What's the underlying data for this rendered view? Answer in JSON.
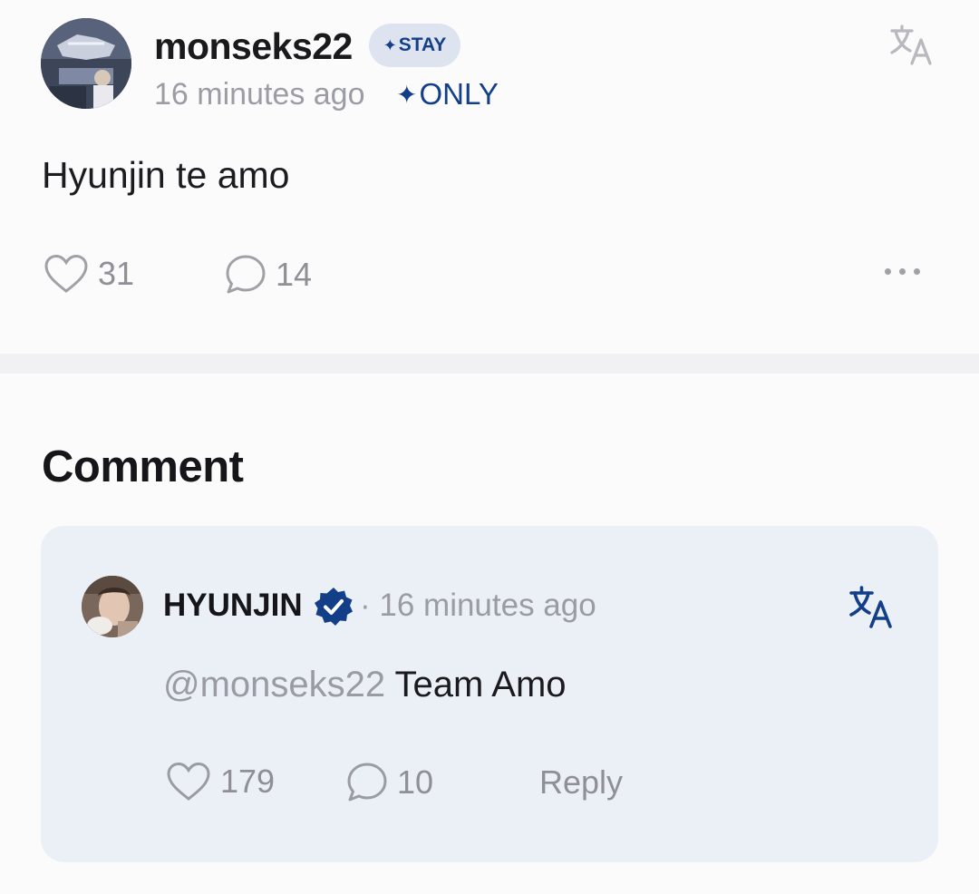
{
  "post": {
    "avatar_icon": "user-avatar-photo",
    "username": "monseks22",
    "stay_badge": {
      "icon": "sparkle-icon",
      "label": "STAY"
    },
    "time": "16 minutes ago",
    "only_badge": {
      "icon": "sparkle-icon",
      "label": "ONLY"
    },
    "translate_icon": "translate-icon",
    "text": "Hyunjin te amo",
    "likes": "31",
    "comments": "14",
    "more_icon": "more-horizontal-icon"
  },
  "comment_section": {
    "heading": "Comment",
    "comment": {
      "avatar_icon": "artist-avatar-photo",
      "author": "HYUNJIN",
      "verified_icon": "verified-badge-icon",
      "time": "· 16 minutes ago",
      "mention": "@monseks22",
      "text": " Team Amo",
      "likes": "179",
      "replies": "10",
      "reply_label": "Reply",
      "translate_icon": "translate-icon"
    }
  },
  "colors": {
    "accent_blue": "#123f88",
    "badge_bg": "#dde3ef",
    "card_bg": "#ebf0f7",
    "muted_text": "#9a9ba3"
  }
}
